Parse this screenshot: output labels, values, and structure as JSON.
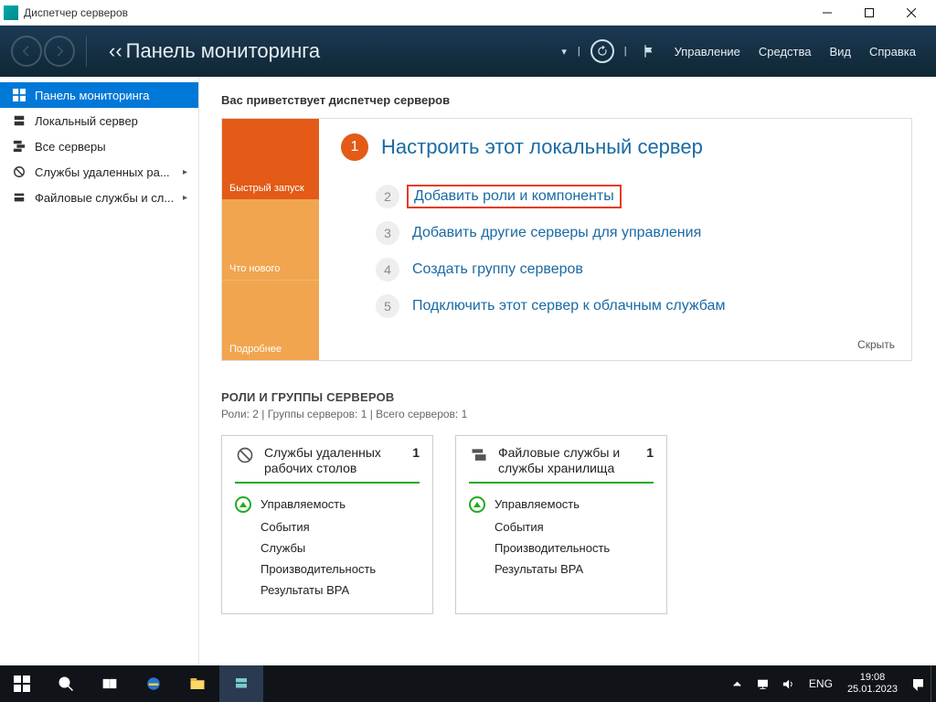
{
  "window": {
    "title": "Диспетчер серверов"
  },
  "header": {
    "page_title": "Панель мониторинга",
    "menu": {
      "manage": "Управление",
      "tools": "Средства",
      "view": "Вид",
      "help": "Справка"
    }
  },
  "sidebar": {
    "items": [
      {
        "label": "Панель мониторинга"
      },
      {
        "label": "Локальный сервер"
      },
      {
        "label": "Все серверы"
      },
      {
        "label": "Службы удаленных ра..."
      },
      {
        "label": "Файловые службы и сл..."
      }
    ]
  },
  "welcome": {
    "title": "Вас приветствует диспетчер серверов",
    "left": {
      "quick": "Быстрый запуск",
      "whatsnew": "Что нового",
      "more": "Подробнее"
    },
    "items": {
      "n1": "1",
      "t1": "Настроить этот локальный сервер",
      "n2": "2",
      "t2": "Добавить роли и компоненты",
      "n3": "3",
      "t3": "Добавить другие серверы для управления",
      "n4": "4",
      "t4": "Создать группу серверов",
      "n5": "5",
      "t5": "Подключить этот сервер к облачным службам"
    },
    "hide": "Скрыть"
  },
  "roles": {
    "heading": "РОЛИ И ГРУППЫ СЕРВЕРОВ",
    "sub": "Роли: 2 | Группы серверов: 1 | Всего серверов: 1",
    "tiles": [
      {
        "title": "Службы удаленных рабочих столов",
        "count": "1",
        "rows": [
          "Управляемость",
          "События",
          "Службы",
          "Производительность",
          "Результаты BPA"
        ]
      },
      {
        "title": "Файловые службы и службы хранилища",
        "count": "1",
        "rows": [
          "Управляемость",
          "События",
          "Производительность",
          "Результаты BPA"
        ]
      }
    ]
  },
  "taskbar": {
    "lang": "ENG",
    "time": "19:08",
    "date": "25.01.2023"
  }
}
